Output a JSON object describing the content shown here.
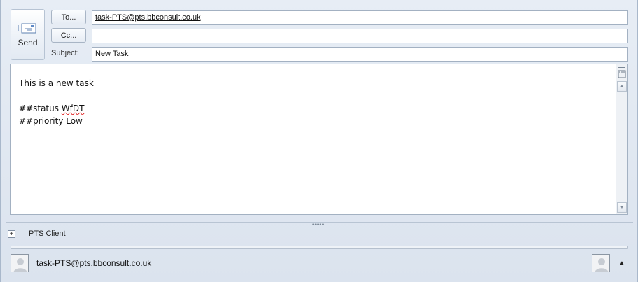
{
  "compose": {
    "send_label": "Send",
    "to_button": "To...",
    "cc_button": "Cc...",
    "to_value": "task-PTS@pts.bbconsult.co.uk",
    "cc_value": "",
    "subject_label": "Subject:",
    "subject_value": "New Task"
  },
  "body": {
    "lines": [
      "This is a new task",
      "",
      "##status ",
      "WfDT",
      "##priority Low"
    ]
  },
  "region": {
    "expand_glyph": "+",
    "label": "PTS Client"
  },
  "people_pane": {
    "name": "task-PTS@pts.bbconsult.co.uk",
    "collapse_glyph": "▲"
  },
  "icons": {
    "send": "envelope-send-icon",
    "ruler": "ruler-icon",
    "scroll_up": "scroll-up-arrow-icon",
    "scroll_down": "scroll-down-arrow-icon",
    "avatar": "person-avatar-icon"
  },
  "colors": {
    "window_bg": "#dde5ef",
    "field_border": "#a3b1c2",
    "spell_error": "#e02020"
  }
}
